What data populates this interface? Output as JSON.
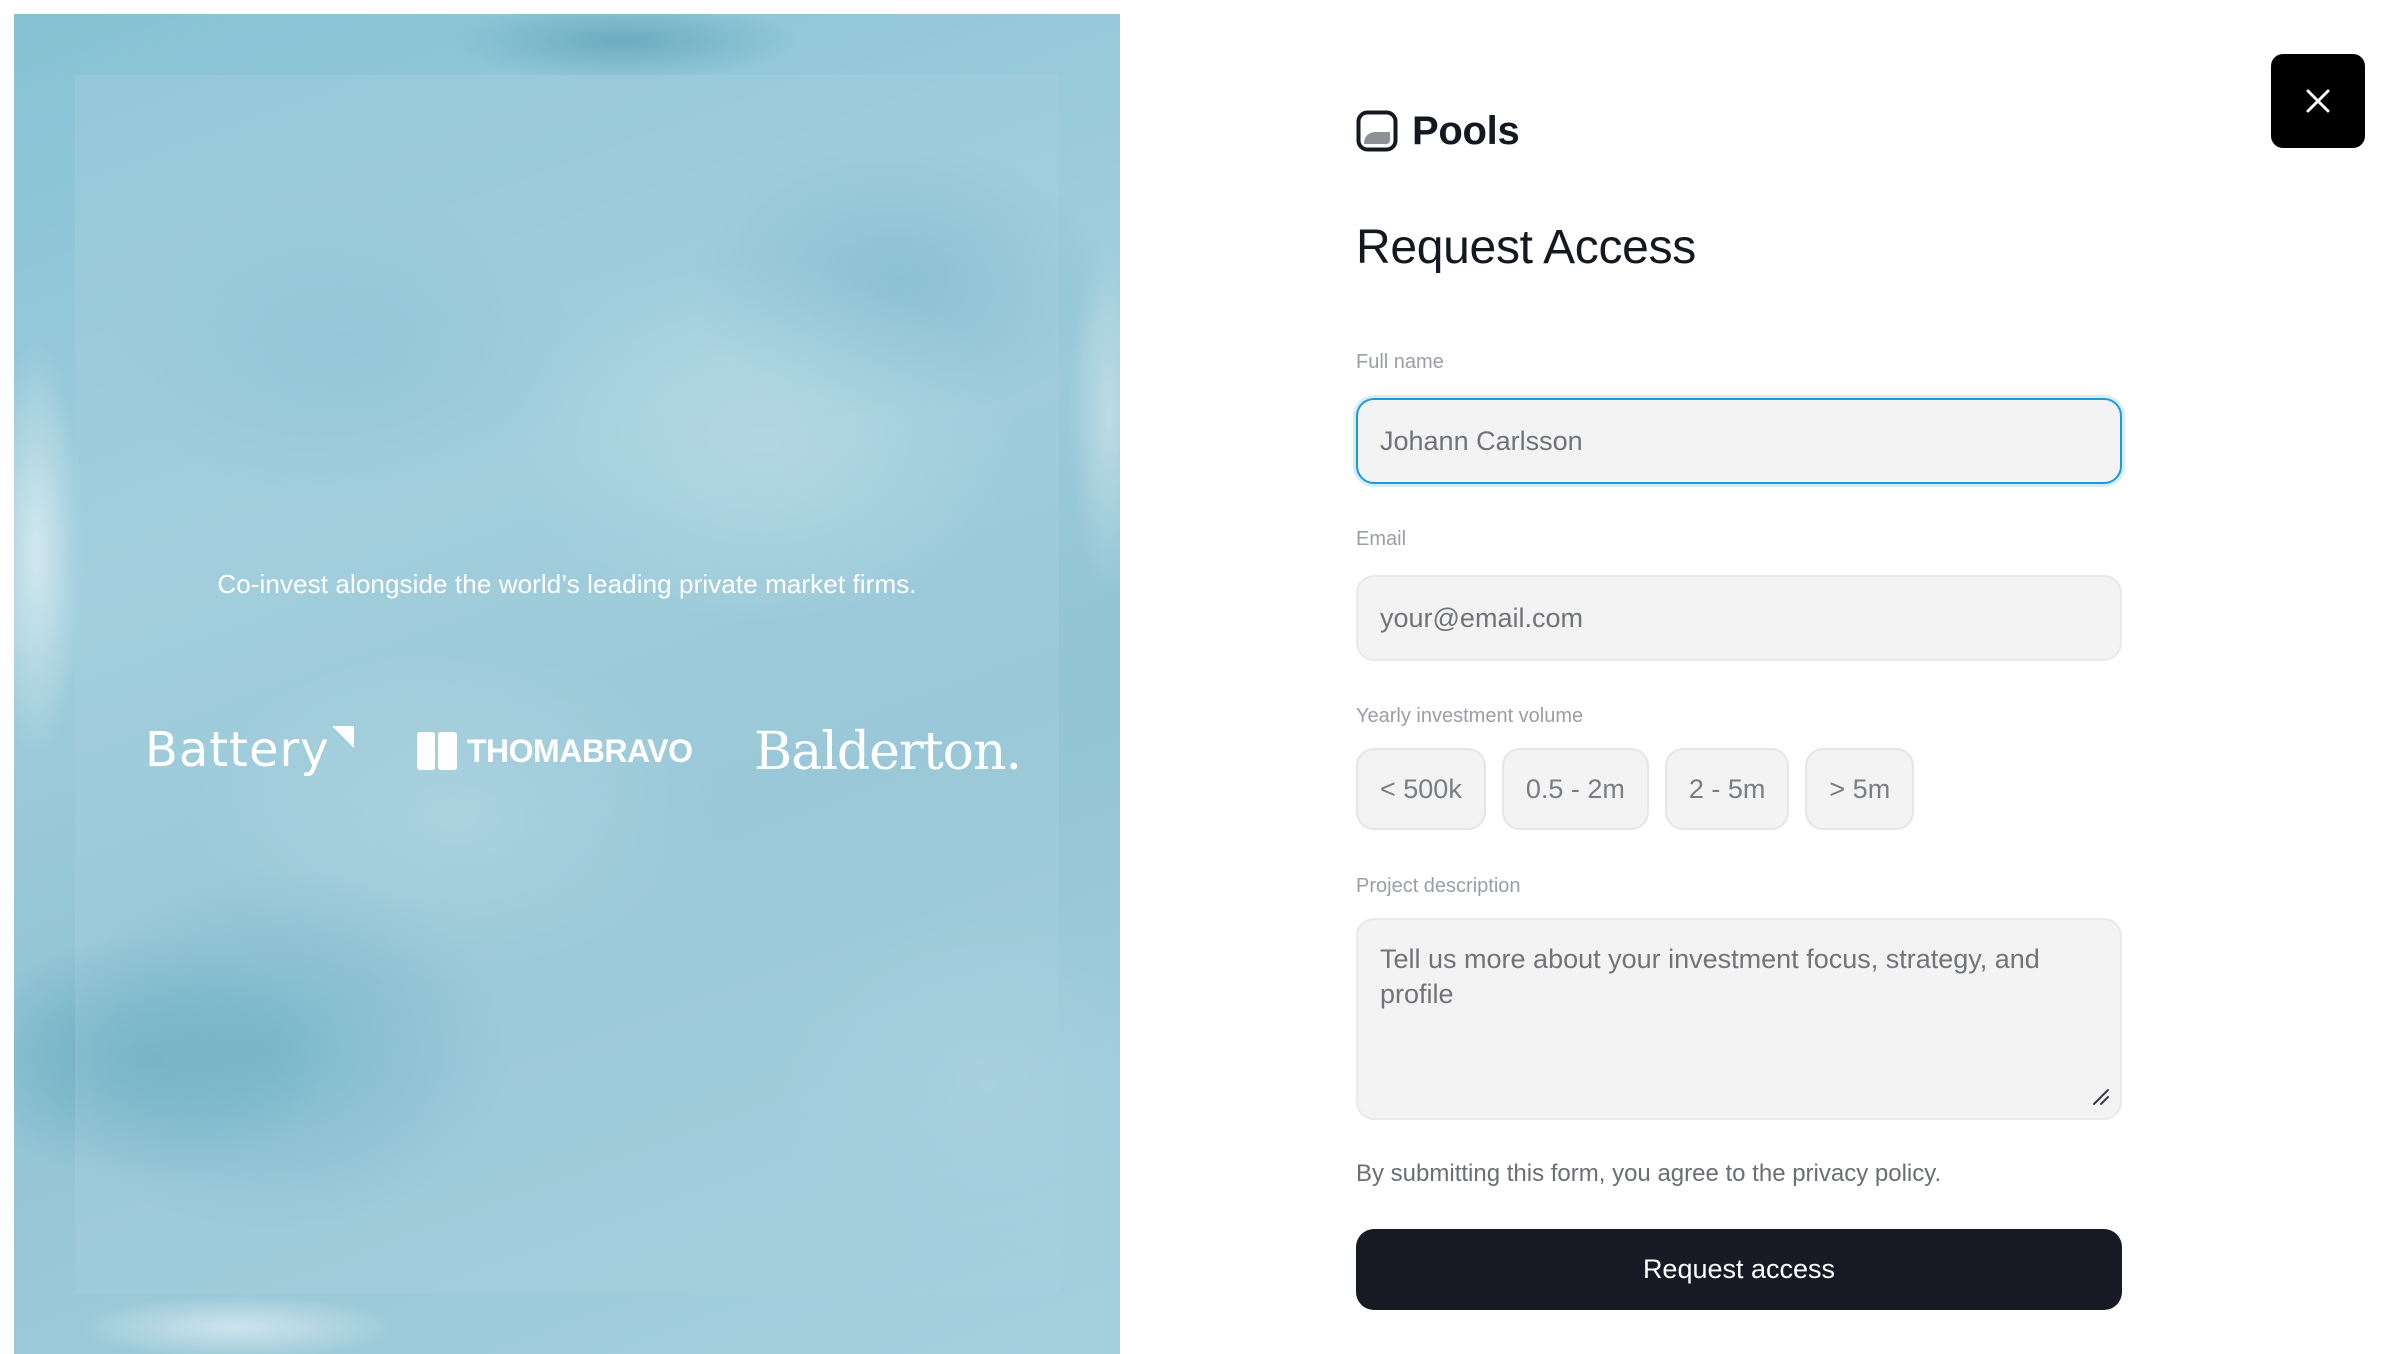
{
  "hero": {
    "tagline": "Co-invest alongside the world’s leading private market firms.",
    "logos": [
      {
        "name": "Battery"
      },
      {
        "name": "THOMABRAVO"
      },
      {
        "name": "Balderton."
      }
    ]
  },
  "brand": {
    "name": "Pools",
    "icon": "pools-logo-icon"
  },
  "form": {
    "title": "Request Access",
    "full_name": {
      "label": "Full name",
      "placeholder": "Johann Carlsson",
      "value": ""
    },
    "email": {
      "label": "Email",
      "placeholder": "your@email.com",
      "value": ""
    },
    "volume": {
      "label": "Yearly investment volume",
      "options": [
        "< 500k",
        "0.5 - 2m",
        "2 - 5m",
        "> 5m"
      ]
    },
    "description": {
      "label": "Project description",
      "placeholder": "Tell us more about your investment focus, strategy, and profile",
      "value": ""
    },
    "consent": "By submitting this form, you agree to the privacy policy.",
    "submit_label": "Request access"
  },
  "close": {
    "icon": "close-icon"
  },
  "colors": {
    "accent_focus": "#1d9ad9",
    "button_dark": "#171a25",
    "hero_base": "#9fcddc"
  }
}
